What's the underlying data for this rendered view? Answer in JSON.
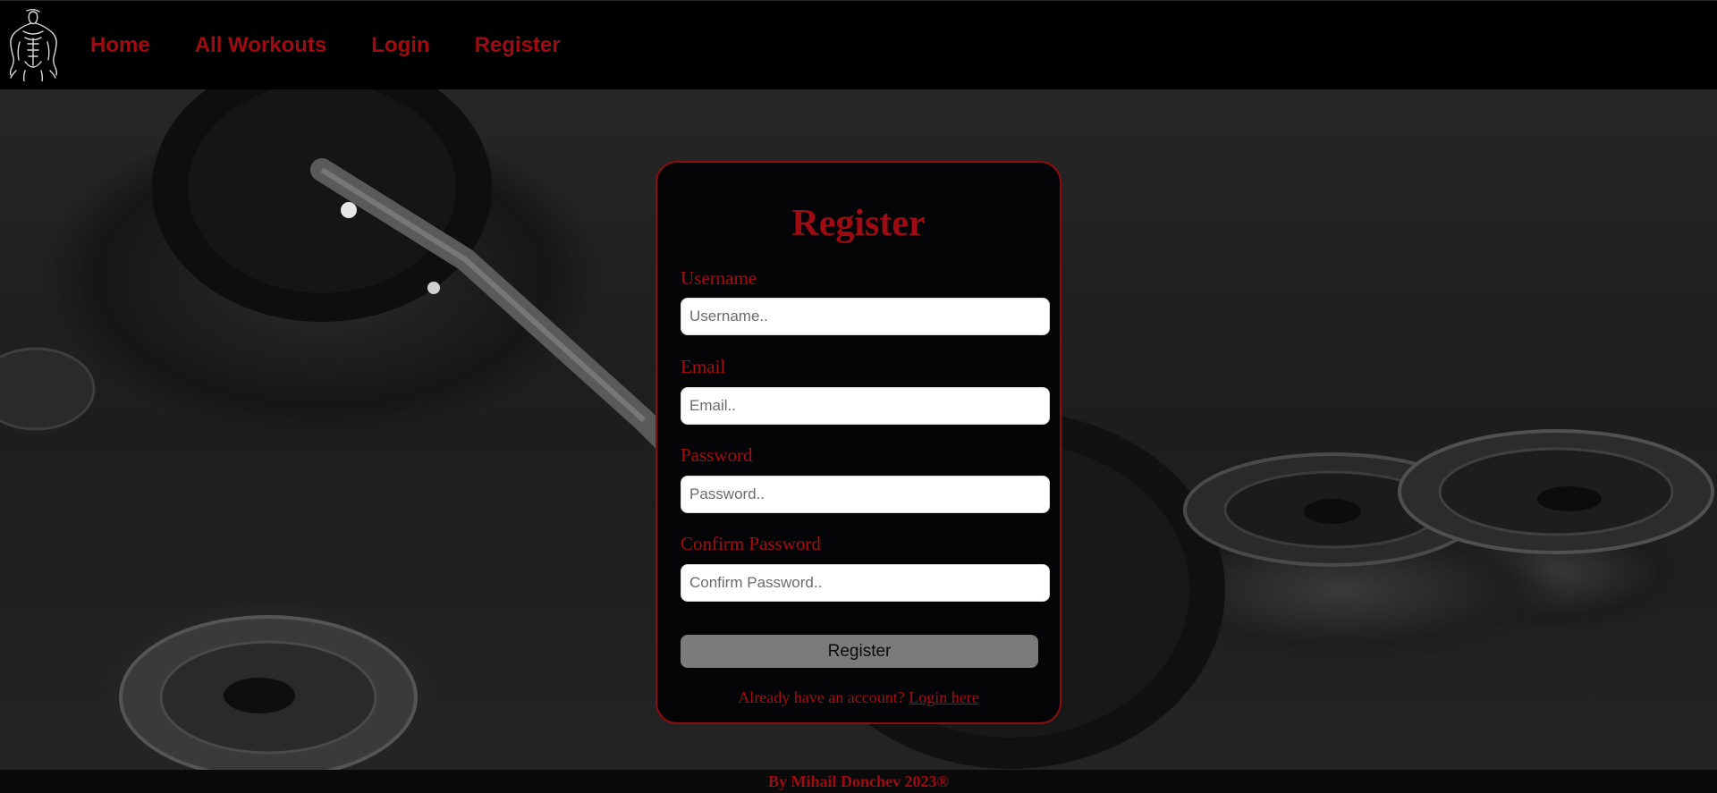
{
  "nav": {
    "logo_icon": "bodybuilder-logo-icon",
    "items": [
      {
        "label": "Home"
      },
      {
        "label": "All Workouts"
      },
      {
        "label": "Login"
      },
      {
        "label": "Register"
      }
    ]
  },
  "form": {
    "title": "Register",
    "fields": [
      {
        "label": "Username",
        "placeholder": "Username..",
        "value": ""
      },
      {
        "label": "Email",
        "placeholder": "Email..",
        "value": ""
      },
      {
        "label": "Password",
        "placeholder": "Password..",
        "value": ""
      },
      {
        "label": "Confirm Password",
        "placeholder": "Confirm Password..",
        "value": ""
      }
    ],
    "submit_label": "Register",
    "login_prompt": "Already have an account?",
    "login_link": "Login here"
  },
  "footer": {
    "text": "By Mihail Donchev 2023®"
  },
  "colors": {
    "accent": "#9e0b12",
    "card_bg": "#050507",
    "header_bg": "#000000",
    "button_bg": "#7b7b7b"
  }
}
